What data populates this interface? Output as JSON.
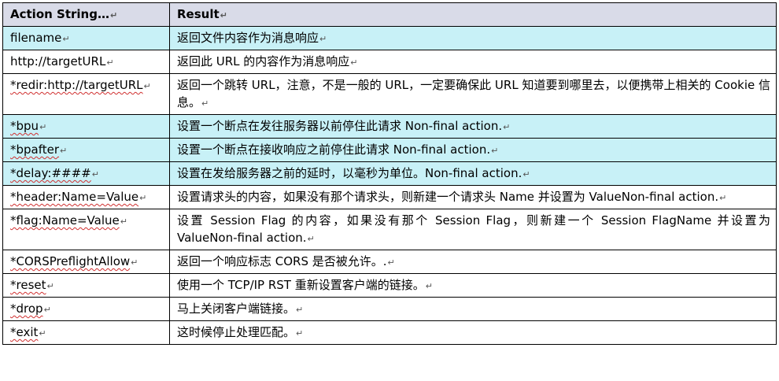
{
  "header": {
    "action": "Action String…",
    "result": "Result"
  },
  "para_mark": "↵",
  "rows": [
    {
      "action": "filename",
      "result": "返回文件内容作为消息响应",
      "highlight": true
    },
    {
      "action": "http://targetURL",
      "result": "返回此 URL 的内容作为消息响应",
      "highlight": false
    },
    {
      "action": "*redir:http://targetURL",
      "result": "返回一个跳转 URL，注意，不是一般的 URL，一定要确保此 URL 知道要到哪里去，以便携带上相关的 Cookie 信息。",
      "highlight": false
    },
    {
      "action": "*bpu",
      "result": "设置一个断点在发往服务器以前停住此请求 Non-final action.",
      "highlight": true
    },
    {
      "action": "*bpafter",
      "result": "设置一个断点在接收响应之前停住此请求 Non-final action.",
      "highlight": true
    },
    {
      "action": "*delay:####",
      "result": "设置在发给服务器之前的延时，以毫秒为单位。Non-final action.",
      "highlight": true
    },
    {
      "action": "*header:Name=Value",
      "result": "设置请求头的内容，如果没有那个请求头，则新建一个请求头 Name 并设置为 ValueNon-final action.",
      "highlight": false
    },
    {
      "action": "*flag:Name=Value",
      "result": " 设置 Session Flag 的内容，如果没有那个 Session Flag，则新建一个 Session FlagName 并设置为 ValueNon-final action.",
      "highlight": false
    },
    {
      "action": "*CORSPreflightAllow",
      "result": "返回一个响应标志 CORS 是否被允许。.",
      "highlight": false
    },
    {
      "action": "*reset",
      "result": " 使用一个 TCP/IP RST 重新设置客户端的链接。",
      "highlight": false
    },
    {
      "action": "*drop",
      "result": "马上关闭客户端链接。",
      "highlight": false
    },
    {
      "action": "*exit",
      "result": "这时候停止处理匹配。",
      "highlight": false
    }
  ]
}
